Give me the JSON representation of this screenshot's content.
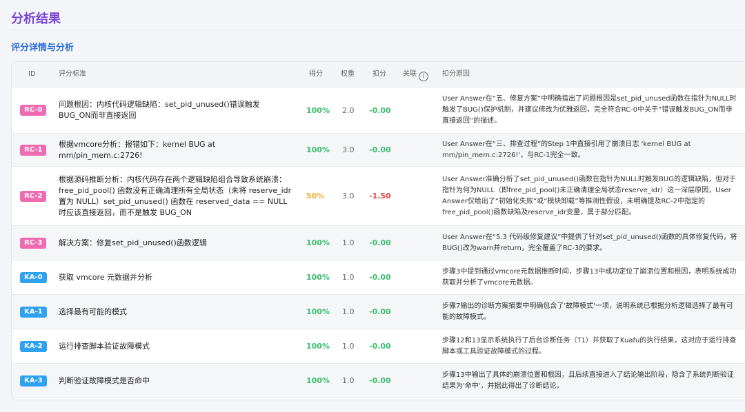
{
  "page": {
    "title": "分析结果",
    "section_title": "评分详情与分析"
  },
  "table": {
    "headers": {
      "id": "ID",
      "criterion": "评分标准",
      "score": "得分",
      "weight": "权重",
      "deduct": "扣分",
      "related": "关联",
      "reason": "扣分原因"
    },
    "rows": [
      {
        "id": "RC-0",
        "type": "rc",
        "criterion": "问题根因：内核代码逻辑缺陷：set_pid_unused()错误触发BUG_ON而非直接返回",
        "score": "100%",
        "weight": "2.0",
        "deduct": "-0.00",
        "reason": "User Answer在“五、修复方案”中明确指出了问题根因是set_pid_unused函数在指针为NULL时触发了BUG()保护机制，并建议修改为优雅返回，完全符合RC-0中关于“错误触发BUG_ON而非直接返回”的描述。"
      },
      {
        "id": "RC-1",
        "type": "rc",
        "criterion": "根据vmcore分析：报错如下：kernel BUG at mm/pin_mem.c:2726!",
        "score": "100%",
        "weight": "3.0",
        "deduct": "-0.00",
        "reason": "User Answer在“三、排查过程”的Step 1中直接引用了崩溃日志 'kernel BUG at mm/pin_mem.c:2726!'，与RC-1完全一致。"
      },
      {
        "id": "RC-2",
        "type": "rc",
        "criterion": "根据源码推断分析：内核代码存在两个逻辑缺陷组合导致系统崩溃：free_pid_pool() 函数没有正确清理所有全局状态（未将 reserve_idr 置为 NULL）set_pid_unused() 函数在 reserved_data == NULL 时应该直接返回，而不是触发 BUG_ON",
        "score": "50%",
        "weight": "3.0",
        "deduct": "-1.50",
        "reason": "User Answer准确分析了set_pid_unused()函数在指针为NULL时触发BUG的逻辑缺陷，但对于指针为何为NULL（即free_pid_pool()未正确清理全局状态reserve_idr）这一深层原因，User Answer仅给出了“初始化失败”或“模块卸载”等推测性假设，未明确提及RC-2中指定的free_pid_pool()函数缺陷及reserve_idr变量，属于部分匹配。"
      },
      {
        "id": "RC-3",
        "type": "rc",
        "criterion": "解决方案：修复set_pid_unused()函数逻辑",
        "score": "100%",
        "weight": "1.0",
        "deduct": "-0.00",
        "reason": "User Answer在“5.3 代码级修复建议”中提供了针对set_pid_unused()函数的具体修复代码，将BUG()改为warn并return，完全覆盖了RC-3的要求。"
      },
      {
        "id": "KA-0",
        "type": "ka",
        "criterion": "获取 vmcore 元数据并分析",
        "score": "100%",
        "weight": "1.0",
        "deduct": "-0.00",
        "reason": "步骤3中提到通过vmcore元数据推断时间，步骤13中成功定位了崩溃位置和根因，表明系统成功获取并分析了vmcore元数据。"
      },
      {
        "id": "KA-1",
        "type": "ka",
        "criterion": "选择最有可能的模式",
        "score": "100%",
        "weight": "1.0",
        "deduct": "-0.00",
        "reason": "步骤7输出的诊断方案摘要中明确包含了'故障模式'一项，说明系统已根据分析逻辑选择了最有可能的故障模式。"
      },
      {
        "id": "KA-2",
        "type": "ka",
        "criterion": "运行排查脚本验证故障模式",
        "score": "100%",
        "weight": "1.0",
        "deduct": "-0.00",
        "reason": "步骤12和13显示系统执行了后台诊断任务（T1）并获取了Kuafu的执行结果，这对应于运行排查脚本或工具验证故障模式的过程。"
      },
      {
        "id": "KA-3",
        "type": "ka",
        "criterion": "判断验证故障模式是否命中",
        "score": "100%",
        "weight": "1.0",
        "deduct": "-0.00",
        "reason": "步骤13中输出了具体的崩溃位置和根因，且后续直接进入了结论输出阶段，隐含了系统判断验证结果为'命中'，并据此得出了诊断结论。"
      }
    ]
  },
  "colors": {
    "title": "#7b46d6",
    "section": "#2f6fd6",
    "rc_badge": "#ee6bb2",
    "ka_badge": "#2ea2f0",
    "score_full": "#3cbf6e",
    "score_half": "#f2b233",
    "deduct_neg": "#e5483e"
  },
  "icons": {
    "related_info": "info-circle-icon"
  }
}
